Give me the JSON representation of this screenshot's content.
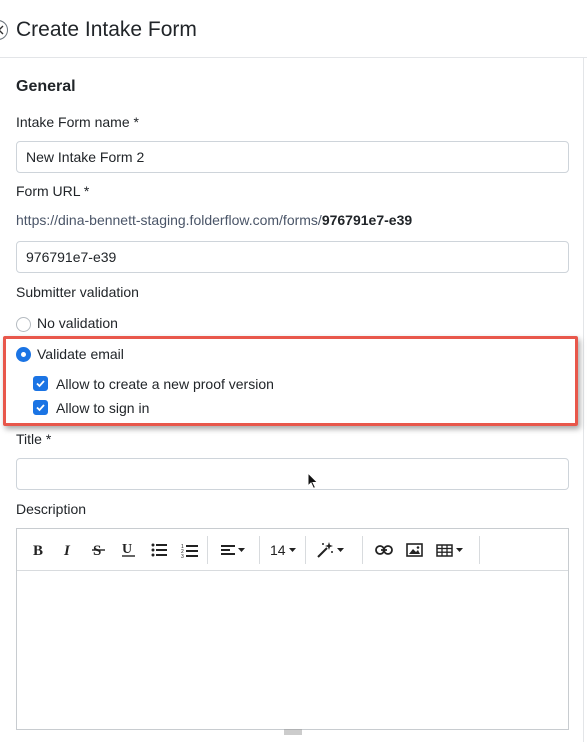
{
  "header": {
    "title": "Create Intake Form"
  },
  "general": {
    "section_title": "General",
    "name_label": "Intake Form name *",
    "name_value": "New Intake Form 2",
    "url_label": "Form URL *",
    "url_base": "https://dina-bennett-staging.folderflow.com/forms/",
    "url_slug": "976791e7-e39",
    "slug_value": "976791e7-e39",
    "validation_label": "Submitter validation",
    "options": {
      "no_validation": "No validation",
      "validate_email": "Validate email",
      "allow_new_proof": "Allow to create a new proof version",
      "allow_sign_in": "Allow to sign in"
    },
    "selected_option": "Validate email",
    "title_label": "Title *",
    "title_value": "",
    "description_label": "Description"
  },
  "editor": {
    "font_size": "14",
    "toolbar_icons": [
      "bold-icon",
      "italic-icon",
      "strikethrough-icon",
      "underline-icon",
      "bullet-list-icon",
      "numbered-list-icon",
      "align-icon",
      "font-size",
      "magic-wand-icon",
      "link-icon",
      "image-icon",
      "table-icon"
    ]
  },
  "colors": {
    "accent": "#1b74e4",
    "highlight": "#e8574b"
  }
}
